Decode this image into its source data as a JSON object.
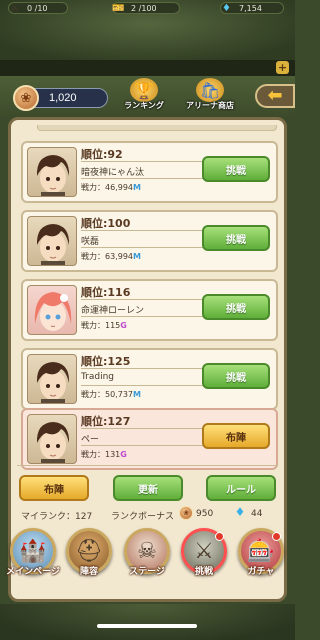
{
  "resources": {
    "stamina": "0 /10",
    "tickets": "2 /100",
    "gems": "7,154",
    "plus": "+"
  },
  "header": {
    "points": "1,020",
    "ranking_label": "ランキング",
    "arena_shop_label": "アリーナ商店",
    "back_arrow": "⬅"
  },
  "opponents": [
    {
      "rank": "順位:92",
      "name": "暗夜神にゃん汰",
      "power_prefix": "戦力：",
      "power_value": "46,994",
      "power_unit": "M",
      "button": "挑戦",
      "avatar": "male"
    },
    {
      "rank": "順位:100",
      "name": "咲磊",
      "power_prefix": "戦力：",
      "power_value": "63,994",
      "power_unit": "M",
      "button": "挑戦",
      "avatar": "male"
    },
    {
      "rank": "順位:116",
      "name": "命運神ローレン",
      "power_prefix": "戦力：",
      "power_value": "115",
      "power_unit": "G",
      "button": "挑戦",
      "avatar": "female"
    },
    {
      "rank": "順位:125",
      "name": "Trading",
      "power_prefix": "戦力：",
      "power_value": "50,737",
      "power_unit": "M",
      "button": "挑戦",
      "avatar": "male"
    },
    {
      "rank": "順位:127",
      "name": "ペー",
      "power_prefix": "戦力：",
      "power_value": "131",
      "power_unit": "G",
      "button": "布陣",
      "avatar": "male",
      "is_self": true
    }
  ],
  "actions": {
    "formation": "布陣",
    "refresh": "更新",
    "rules": "ルール"
  },
  "footer": {
    "my_rank": "マイランク：127",
    "bonus_label": "ランクボーナス",
    "bonus_points": "950",
    "bonus_gems": "44"
  },
  "nav": [
    {
      "label": "メインページ",
      "icon": "castle-icon"
    },
    {
      "label": "陣容",
      "icon": "helmet-icon"
    },
    {
      "label": "ステージ",
      "icon": "pirate-icon"
    },
    {
      "label": "挑戦",
      "icon": "swords-icon"
    },
    {
      "label": "ガチャ",
      "icon": "gacha-icon"
    }
  ],
  "colors": {
    "accent_green": "#5fae3a",
    "accent_yellow": "#e5a92a",
    "power_M": "#3a9ad8",
    "power_G": "#c04ad0"
  }
}
